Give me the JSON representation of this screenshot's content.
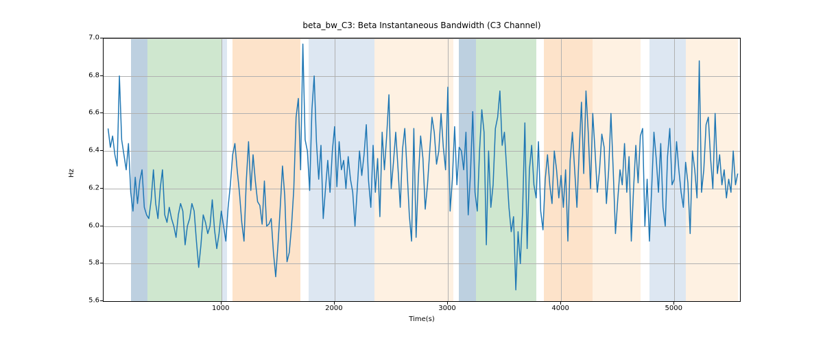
{
  "chart_data": {
    "type": "line",
    "title": "beta_bw_C3: Beta Instantaneous Bandwidth (C3 Channel)",
    "xlabel": "Time(s)",
    "ylabel": "Hz",
    "xlim": [
      -40,
      5580
    ],
    "ylim": [
      5.6,
      7.0
    ],
    "xticks": [
      1000,
      2000,
      3000,
      4000,
      5000
    ],
    "yticks": [
      5.6,
      5.8,
      6.0,
      6.2,
      6.4,
      6.6,
      6.8,
      7.0
    ],
    "bands": [
      {
        "x0": 200,
        "x1": 350,
        "color": "blue1"
      },
      {
        "x0": 350,
        "x1": 1000,
        "color": "green1"
      },
      {
        "x0": 1000,
        "x1": 1050,
        "color": "blue2"
      },
      {
        "x0": 1100,
        "x1": 1700,
        "color": "orange1"
      },
      {
        "x0": 1770,
        "x1": 2350,
        "color": "blue2"
      },
      {
        "x0": 2350,
        "x1": 3050,
        "color": "orange2"
      },
      {
        "x0": 3100,
        "x1": 3250,
        "color": "blue1"
      },
      {
        "x0": 3250,
        "x1": 3780,
        "color": "green1"
      },
      {
        "x0": 3850,
        "x1": 4280,
        "color": "orange1"
      },
      {
        "x0": 4280,
        "x1": 4700,
        "color": "orange2"
      },
      {
        "x0": 4780,
        "x1": 5100,
        "color": "blue2"
      },
      {
        "x0": 5100,
        "x1": 5560,
        "color": "orange2"
      }
    ],
    "series": [
      {
        "name": "beta_bw_C3",
        "x_start": 0,
        "x_step": 20,
        "values": [
          6.52,
          6.42,
          6.48,
          6.38,
          6.32,
          6.8,
          6.46,
          6.38,
          6.3,
          6.44,
          6.18,
          6.08,
          6.26,
          6.12,
          6.24,
          6.3,
          6.1,
          6.06,
          6.04,
          6.14,
          6.3,
          6.12,
          6.04,
          6.2,
          6.3,
          6.06,
          6.02,
          6.1,
          6.04,
          6.0,
          5.94,
          6.06,
          6.12,
          6.08,
          5.9,
          6.0,
          6.04,
          6.12,
          6.08,
          5.92,
          5.78,
          5.9,
          6.06,
          6.02,
          5.96,
          6.0,
          6.14,
          5.98,
          5.88,
          5.96,
          6.08,
          6.0,
          5.92,
          6.1,
          6.22,
          6.38,
          6.44,
          6.3,
          6.18,
          6.02,
          5.92,
          6.24,
          6.45,
          6.19,
          6.38,
          6.24,
          6.13,
          6.11,
          6.01,
          6.24,
          6.0,
          6.01,
          6.04,
          5.86,
          5.73,
          5.9,
          6.1,
          6.32,
          6.16,
          5.81,
          5.86,
          6.0,
          6.2,
          6.58,
          6.68,
          6.3,
          6.97,
          6.46,
          6.4,
          6.19,
          6.62,
          6.8,
          6.45,
          6.25,
          6.43,
          6.04,
          6.2,
          6.35,
          6.18,
          6.4,
          6.53,
          6.21,
          6.45,
          6.3,
          6.35,
          6.2,
          6.37,
          6.25,
          6.18,
          6.0,
          6.2,
          6.4,
          6.27,
          6.38,
          6.54,
          6.24,
          6.1,
          6.43,
          6.18,
          6.36,
          6.05,
          6.5,
          6.3,
          6.48,
          6.7,
          6.2,
          6.34,
          6.5,
          6.31,
          6.1,
          6.41,
          6.52,
          6.3,
          6.06,
          5.92,
          6.52,
          5.94,
          6.26,
          6.48,
          6.36,
          6.09,
          6.22,
          6.4,
          6.58,
          6.5,
          6.33,
          6.4,
          6.6,
          6.42,
          6.3,
          6.74,
          6.08,
          6.25,
          6.53,
          6.22,
          6.42,
          6.4,
          6.3,
          6.5,
          6.06,
          6.28,
          6.61,
          6.18,
          6.08,
          6.4,
          6.62,
          6.5,
          5.9,
          6.4,
          6.1,
          6.22,
          6.52,
          6.58,
          6.72,
          6.43,
          6.5,
          6.3,
          6.1,
          5.97,
          6.05,
          5.66,
          5.97,
          5.8,
          6.08,
          6.55,
          5.88,
          6.3,
          6.43,
          6.22,
          6.15,
          6.45,
          6.08,
          5.98,
          6.25,
          6.38,
          6.22,
          6.12,
          6.4,
          6.3,
          6.15,
          6.27,
          6.1,
          6.3,
          5.92,
          6.35,
          6.5,
          6.3,
          6.1,
          6.4,
          6.66,
          6.28,
          6.72,
          6.5,
          6.2,
          6.6,
          6.4,
          6.18,
          6.3,
          6.49,
          6.42,
          6.12,
          6.3,
          6.6,
          6.3,
          5.96,
          6.14,
          6.3,
          6.22,
          6.44,
          6.18,
          6.37,
          5.92,
          6.2,
          6.43,
          6.23,
          6.48,
          6.52,
          6.0,
          6.25,
          5.92,
          6.2,
          6.5,
          6.36,
          6.18,
          6.44,
          6.1,
          6.0,
          6.37,
          6.52,
          6.22,
          6.25,
          6.45,
          6.3,
          6.18,
          6.1,
          6.34,
          6.23,
          5.96,
          6.4,
          6.3,
          6.15,
          6.88,
          6.18,
          6.3,
          6.54,
          6.58,
          6.36,
          6.2,
          6.6,
          6.28,
          6.38,
          6.22,
          6.3,
          6.15,
          6.25,
          6.18,
          6.4,
          6.22,
          6.28
        ]
      }
    ]
  }
}
